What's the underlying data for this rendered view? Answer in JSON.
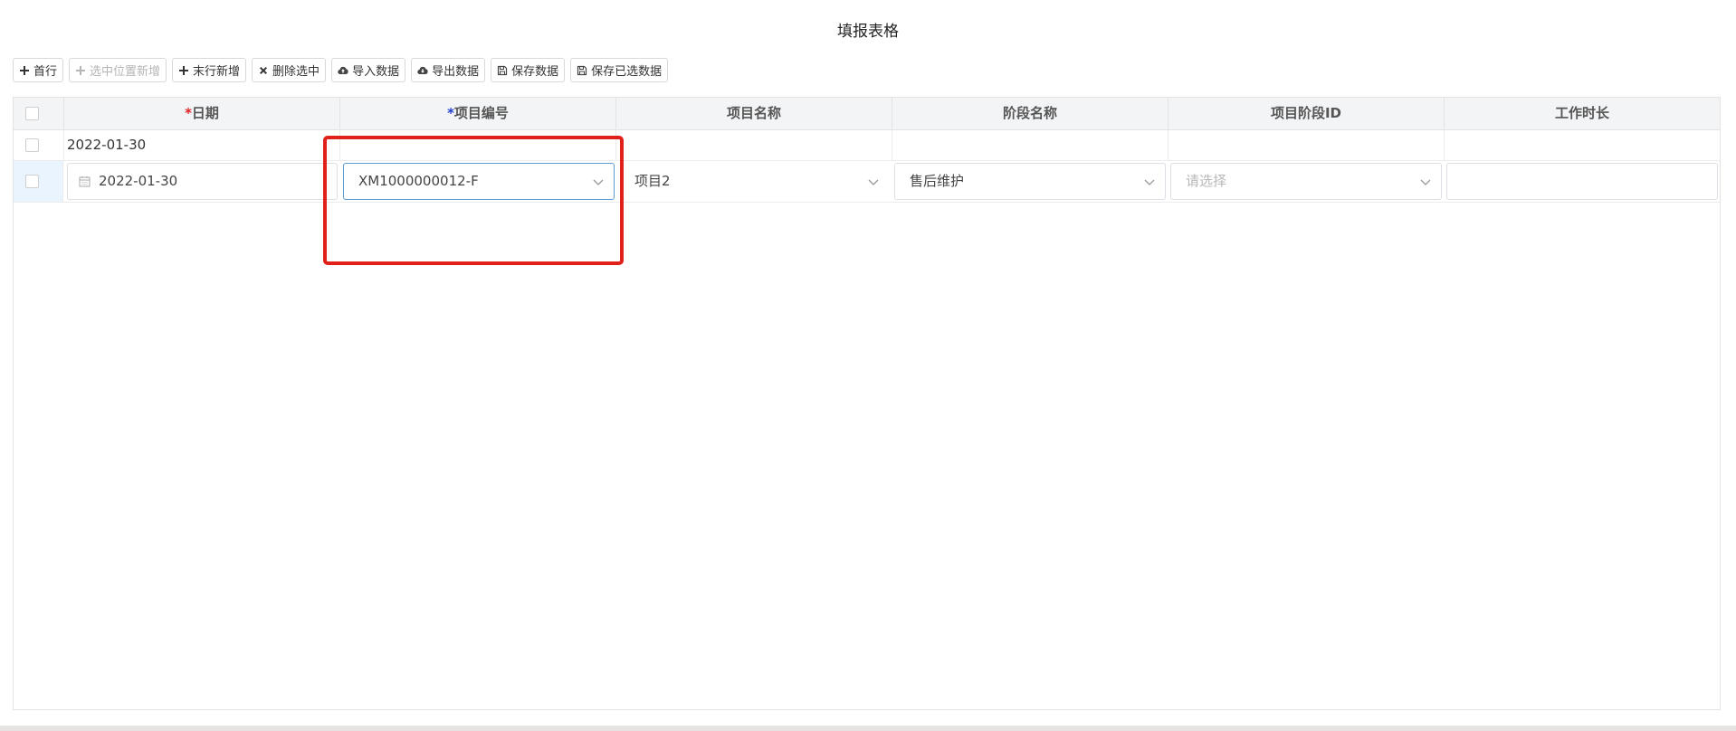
{
  "page": {
    "title": "填报表格"
  },
  "toolbar": {
    "buttons": [
      {
        "label": "首行",
        "icon": "plus-icon",
        "disabled": false
      },
      {
        "label": "选中位置新增",
        "icon": "plus-icon",
        "disabled": true
      },
      {
        "label": "末行新增",
        "icon": "plus-icon",
        "disabled": false
      },
      {
        "label": "删除选中",
        "icon": "close-icon",
        "disabled": false
      },
      {
        "label": "导入数据",
        "icon": "cloud-upload-icon",
        "disabled": false
      },
      {
        "label": "导出数据",
        "icon": "cloud-download-icon",
        "disabled": false
      },
      {
        "label": "保存数据",
        "icon": "save-icon",
        "disabled": false
      },
      {
        "label": "保存已选数据",
        "icon": "save-icon",
        "disabled": false
      }
    ]
  },
  "grid": {
    "columns": [
      {
        "label": "日期",
        "required": true,
        "required_color": "#e02020"
      },
      {
        "label": "项目编号",
        "required": true,
        "required_color": "#1f3fd0"
      },
      {
        "label": "项目名称",
        "required": false
      },
      {
        "label": "阶段名称",
        "required": false
      },
      {
        "label": "项目阶段ID",
        "required": false
      },
      {
        "label": "工作时长",
        "required": false
      }
    ],
    "required_mark": "*",
    "rows": [
      {
        "date": "2022-01-30",
        "project_code": "",
        "project_name": "",
        "stage_name": "",
        "stage_id": "",
        "work_hours": ""
      }
    ],
    "edit_row": {
      "date": "2022-01-30",
      "project_code": "XM1000000012-F",
      "project_name": "项目2",
      "stage_name": "售后维护",
      "stage_id_placeholder": "请选择",
      "work_hours": ""
    }
  },
  "colors": {
    "highlight": "#e0211b",
    "focus_border": "#5b9bd5",
    "header_bg": "#f3f4f6",
    "selected_row_bg": "#eaf4ff"
  }
}
